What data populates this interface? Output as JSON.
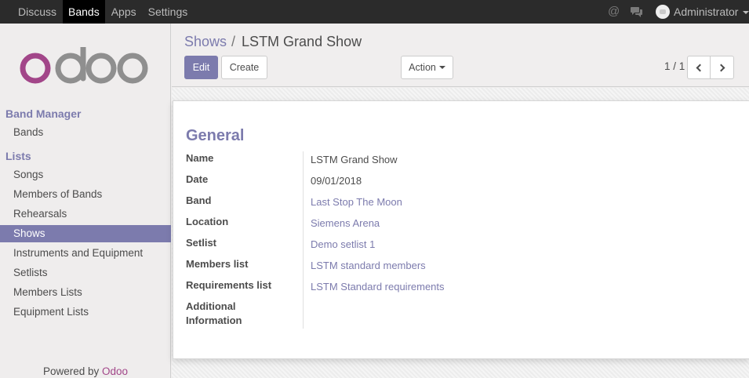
{
  "topbar": {
    "menu": [
      "Discuss",
      "Bands",
      "Apps",
      "Settings"
    ],
    "active_menu": "Bands",
    "user_name": "Administrator"
  },
  "sidebar": {
    "logo_text": "odoo",
    "sections": [
      {
        "title": "Band Manager",
        "items": [
          "Bands"
        ]
      },
      {
        "title": "Lists",
        "items": [
          "Songs",
          "Members of Bands",
          "Rehearsals",
          "Shows",
          "Instruments and Equipment",
          "Setlists",
          "Members Lists",
          "Equipment Lists"
        ]
      }
    ],
    "active_item": "Shows",
    "powered_by": "Powered by",
    "powered_brand": "Odoo"
  },
  "breadcrumb": {
    "parent": "Shows",
    "separator": "/",
    "current": "LSTM Grand Show"
  },
  "buttons": {
    "edit": "Edit",
    "create": "Create",
    "action": "Action"
  },
  "pager": {
    "value": "1 / 1"
  },
  "form": {
    "group_title": "General",
    "fields": [
      {
        "label": "Name",
        "value": "LSTM Grand Show",
        "is_link": false
      },
      {
        "label": "Date",
        "value": "09/01/2018",
        "is_link": false
      },
      {
        "label": "Band",
        "value": "Last Stop The Moon",
        "is_link": true
      },
      {
        "label": "Location",
        "value": "Siemens Arena",
        "is_link": true
      },
      {
        "label": "Setlist",
        "value": "Demo setlist 1",
        "is_link": true
      },
      {
        "label": "Members list",
        "value": "LSTM standard members",
        "is_link": true
      },
      {
        "label": "Requirements list",
        "value": "LSTM Standard requirements",
        "is_link": true
      },
      {
        "label": "Additional Information",
        "value": "",
        "is_link": false
      }
    ]
  },
  "colors": {
    "accent": "#7c7bad",
    "topbar": "#2b2b2b",
    "brand_logo": "#a24689"
  },
  "icons": [
    "at-icon",
    "chat-icon",
    "avatar",
    "caret-down-icon",
    "chevron-left-icon",
    "chevron-right-icon"
  ]
}
